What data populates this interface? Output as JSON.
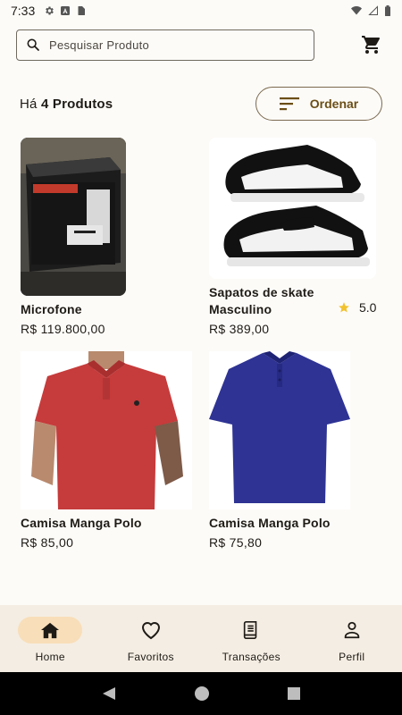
{
  "status": {
    "time": "7:33"
  },
  "search": {
    "placeholder": "Pesquisar Produto"
  },
  "header": {
    "count_prefix": "Há ",
    "count_bold": "4 Produtos",
    "sort_label": "Ordenar"
  },
  "products": [
    {
      "name": "Microfone",
      "price": "R$ 119.800,00",
      "image": "microphone-box-photo"
    },
    {
      "name": "Sapatos de skate Masculino",
      "price": "R$ 389,00",
      "rating": "5.0",
      "image": "sneakers-photo"
    },
    {
      "name": "Camisa Manga Polo",
      "price": "R$ 85,00",
      "image": "red-polo-photo"
    },
    {
      "name": "Camisa Manga Polo",
      "price": "R$ 75,80",
      "image": "blue-polo-photo"
    }
  ],
  "nav": {
    "items": [
      {
        "label": "Home",
        "icon": "home-icon",
        "active": true
      },
      {
        "label": "Favoritos",
        "icon": "heart-icon"
      },
      {
        "label": "Transações",
        "icon": "receipt-icon"
      },
      {
        "label": "Perfil",
        "icon": "person-icon"
      }
    ]
  },
  "colors": {
    "accent_pill": "#f8deb9",
    "sort_text": "#6b4e16",
    "star": "#f2c12e",
    "nav_bg": "#f4ede3"
  }
}
